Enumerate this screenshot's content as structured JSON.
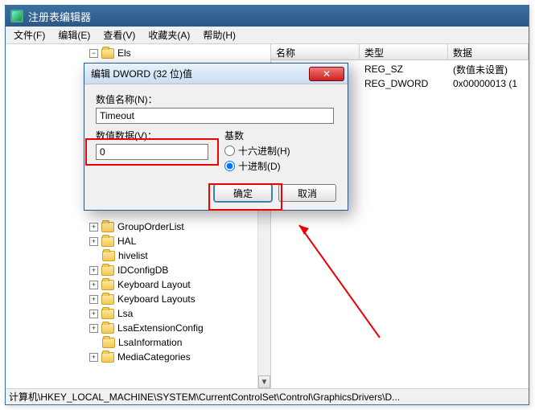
{
  "window": {
    "title": "注册表编辑器"
  },
  "menu": {
    "file": "文件(F)",
    "edit": "编辑(E)",
    "view": "查看(V)",
    "favorites": "收藏夹(A)",
    "help": "帮助(H)"
  },
  "tree": {
    "top_item": "Els",
    "items": [
      "GroupOrderList",
      "HAL",
      "hivelist",
      "IDConfigDB",
      "Keyboard Layout",
      "Keyboard Layouts",
      "Lsa",
      "LsaExtensionConfig",
      "LsaInformation",
      "MediaCategories"
    ],
    "expander_plus": "+",
    "expander_minus": "−"
  },
  "list": {
    "col_name": "名称",
    "col_type": "类型",
    "col_data": "数据",
    "rows": [
      {
        "name": "",
        "type": "REG_SZ",
        "data": "(数值未设置)"
      },
      {
        "name": "",
        "type": "REG_DWORD",
        "data": "0x00000013 (1"
      }
    ]
  },
  "dialog": {
    "title": "编辑 DWORD (32 位)值",
    "close_x": "✕",
    "name_label": "数值名称(N)：",
    "name_value": "Timeout",
    "data_label": "数值数据(V)：",
    "data_value": "0",
    "radix_label": "基数",
    "radix_hex": "十六进制(H)",
    "radix_dec": "十进制(D)",
    "ok": "确定",
    "cancel": "取消"
  },
  "statusbar": {
    "path": "计算机\\HKEY_LOCAL_MACHINE\\SYSTEM\\CurrentControlSet\\Control\\GraphicsDrivers\\D..."
  }
}
